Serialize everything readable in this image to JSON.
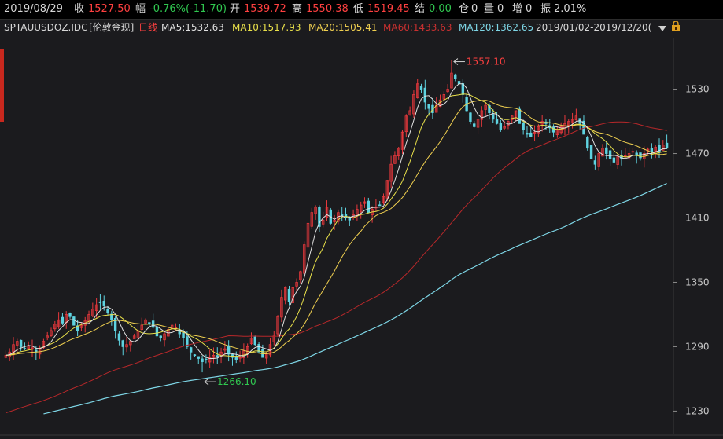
{
  "header": {
    "date": "2019/08/29",
    "close_label": "收",
    "close_value": "1527.50",
    "change_label": "幅",
    "change_value": "-0.76%(-11.70)",
    "open_label": "开",
    "open_value": "1539.72",
    "high_label": "高",
    "high_value": "1550.38",
    "low_label": "低",
    "low_value": "1519.45",
    "settle_label": "结",
    "settle_value": "0.00",
    "position_label": "仓",
    "position_value": "0",
    "volume_label": "量",
    "volume_value": "0",
    "increase_label": "增",
    "increase_value": "0",
    "amplitude_label": "振",
    "amplitude_value": "2.01%"
  },
  "legend": {
    "symbol": "SPTAUUSDOZ.IDC",
    "name": "[伦敦金现]",
    "period": "日线",
    "ma5": "MA5:1532.63",
    "ma10": "MA10:1517.93",
    "ma20": "MA20:1505.41",
    "ma60": "MA60:1433.63",
    "ma120": "MA120:1362.65",
    "date_range": "2019/01/02-2019/12/20(",
    "dropdown_icon": "triangle-down-icon",
    "lock_icon": "lock-icon"
  },
  "colors": {
    "up": "#e8383c",
    "down": "#5fd3e0",
    "ma5": "#e0e0e0",
    "ma10": "#e8e04a",
    "ma20": "#f0d050",
    "ma60": "#b8282a",
    "ma120": "#7ed6e6",
    "value_up": "#ff4040",
    "value_down": "#30c850",
    "background": "#1b1b1e"
  },
  "chart_data": {
    "type": "candlestick",
    "title": "SPTAUUSDOZ.IDC [伦敦金现] 日线",
    "y_axis_ticks": [
      1230,
      1290,
      1350,
      1410,
      1470,
      1530
    ],
    "ylim": [
      1212,
      1578
    ],
    "x_range": [
      "2019/01/02",
      "2019/12/20"
    ],
    "annotations": [
      {
        "text": "1557.10",
        "value": 1557.1,
        "type": "high"
      },
      {
        "text": "1266.10",
        "value": 1266.1,
        "type": "low"
      }
    ],
    "close_path": [
      1282,
      1285,
      1292,
      1295,
      1290,
      1288,
      1291,
      1289,
      1285,
      1288,
      1295,
      1300,
      1305,
      1311,
      1315,
      1312,
      1320,
      1318,
      1310,
      1305,
      1310,
      1314,
      1320,
      1325,
      1329,
      1331,
      1328,
      1322,
      1315,
      1305,
      1296,
      1290,
      1292,
      1295,
      1300,
      1305,
      1310,
      1315,
      1312,
      1308,
      1300,
      1298,
      1302,
      1306,
      1310,
      1308,
      1302,
      1298,
      1290,
      1285,
      1282,
      1279,
      1276,
      1278,
      1280,
      1282,
      1281,
      1285,
      1288,
      1283,
      1280,
      1278,
      1280,
      1286,
      1290,
      1298,
      1292,
      1285,
      1280,
      1284,
      1292,
      1300,
      1318,
      1336,
      1345,
      1332,
      1345,
      1350,
      1360,
      1385,
      1405,
      1415,
      1420,
      1402,
      1408,
      1420,
      1405,
      1408,
      1415,
      1412,
      1410,
      1408,
      1413,
      1418,
      1422,
      1425,
      1415,
      1418,
      1420,
      1422,
      1430,
      1445,
      1460,
      1468,
      1475,
      1490,
      1505,
      1510,
      1525,
      1535,
      1530,
      1518,
      1512,
      1508,
      1515,
      1520,
      1525,
      1530,
      1545,
      1540,
      1535,
      1525,
      1510,
      1500,
      1495,
      1502,
      1510,
      1515,
      1508,
      1502,
      1498,
      1492,
      1495,
      1500,
      1505,
      1510,
      1498,
      1492,
      1488,
      1486,
      1490,
      1495,
      1500,
      1498,
      1494,
      1490,
      1492,
      1495,
      1498,
      1500,
      1502,
      1505,
      1498,
      1488,
      1475,
      1465,
      1460,
      1470,
      1475,
      1470,
      1465,
      1462,
      1467,
      1465,
      1468,
      1470,
      1472,
      1468,
      1466,
      1470,
      1474,
      1472,
      1476,
      1472,
      1478,
      1475
    ],
    "series": [
      {
        "name": "MA5",
        "last": 1532.63
      },
      {
        "name": "MA10",
        "last": 1517.93
      },
      {
        "name": "MA20",
        "last": 1505.41
      },
      {
        "name": "MA60",
        "last": 1433.63
      },
      {
        "name": "MA120",
        "last": 1362.65
      }
    ],
    "grid": false,
    "legend_position": "top-left"
  }
}
